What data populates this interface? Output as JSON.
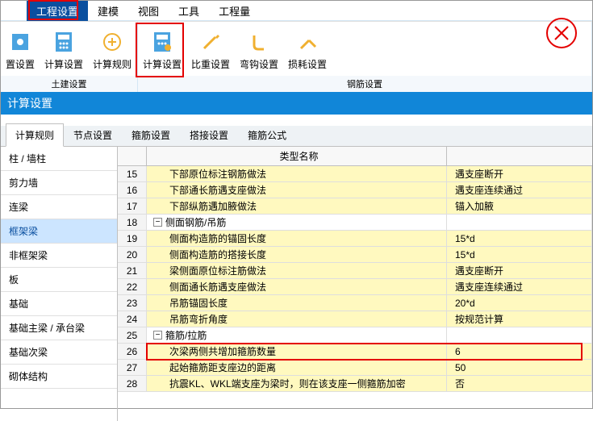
{
  "menubar": {
    "items": [
      "工程设置",
      "建模",
      "视图",
      "工具",
      "工程量"
    ],
    "selected_index": 0
  },
  "ribbon": {
    "group1_caption": "土建设置",
    "group2_caption": "钢筋设置",
    "group1": [
      {
        "label": "置设置",
        "icon": "gear-icon"
      },
      {
        "label": "计算设置",
        "icon": "calc-icon"
      },
      {
        "label": "计算规则",
        "icon": "rule-icon"
      }
    ],
    "group2": [
      {
        "label": "计算设置",
        "icon": "calc-icon"
      },
      {
        "label": "比重设置",
        "icon": "pen-icon"
      },
      {
        "label": "弯钩设置",
        "icon": "hook-icon"
      },
      {
        "label": "损耗设置",
        "icon": "loss-icon"
      }
    ]
  },
  "section_title": "计算设置",
  "tabs": [
    "计算规则",
    "节点设置",
    "箍筋设置",
    "搭接设置",
    "箍筋公式"
  ],
  "active_tab": 0,
  "sidebar": {
    "items": [
      "柱 / 墙柱",
      "剪力墙",
      "连梁",
      "框架梁",
      "非框架梁",
      "板",
      "基础",
      "基础主梁 / 承台梁",
      "基础次梁",
      "砌体结构"
    ],
    "active_index": 3
  },
  "grid": {
    "header_name": "类型名称",
    "rows": [
      {
        "num": 15,
        "name": "下部原位标注钢筋做法",
        "value": "遇支座断开",
        "indent": 2,
        "yellow": true
      },
      {
        "num": 16,
        "name": "下部通长筋遇支座做法",
        "value": "遇支座连续通过",
        "indent": 2,
        "yellow": true
      },
      {
        "num": 17,
        "name": "下部纵筋遇加腋做法",
        "value": "锚入加腋",
        "indent": 2,
        "yellow": true
      },
      {
        "num": 18,
        "name": "侧面钢筋/吊筋",
        "value": "",
        "indent": 1,
        "collapsible": true
      },
      {
        "num": 19,
        "name": "侧面构造筋的锚固长度",
        "value": "15*d",
        "indent": 2,
        "yellow": true
      },
      {
        "num": 20,
        "name": "侧面构造筋的搭接长度",
        "value": "15*d",
        "indent": 2,
        "yellow": true
      },
      {
        "num": 21,
        "name": "梁侧面原位标注筋做法",
        "value": "遇支座断开",
        "indent": 2,
        "yellow": true
      },
      {
        "num": 22,
        "name": "侧面通长筋遇支座做法",
        "value": "遇支座连续通过",
        "indent": 2,
        "yellow": true
      },
      {
        "num": 23,
        "name": "吊筋锚固长度",
        "value": "20*d",
        "indent": 2,
        "yellow": true
      },
      {
        "num": 24,
        "name": "吊筋弯折角度",
        "value": "按规范计算",
        "indent": 2,
        "yellow": true
      },
      {
        "num": 25,
        "name": "箍筋/拉筋",
        "value": "",
        "indent": 1,
        "collapsible": true
      },
      {
        "num": 26,
        "name": "次梁两侧共增加箍筋数量",
        "value": "6",
        "indent": 2,
        "yellow": true
      },
      {
        "num": 27,
        "name": "起始箍筋距支座边的距离",
        "value": "50",
        "indent": 2,
        "yellow": true
      },
      {
        "num": 28,
        "name": "抗震KL、WKL端支座为梁时，则在该支座一侧箍筋加密",
        "value": "否",
        "indent": 2,
        "yellow": true
      }
    ]
  }
}
